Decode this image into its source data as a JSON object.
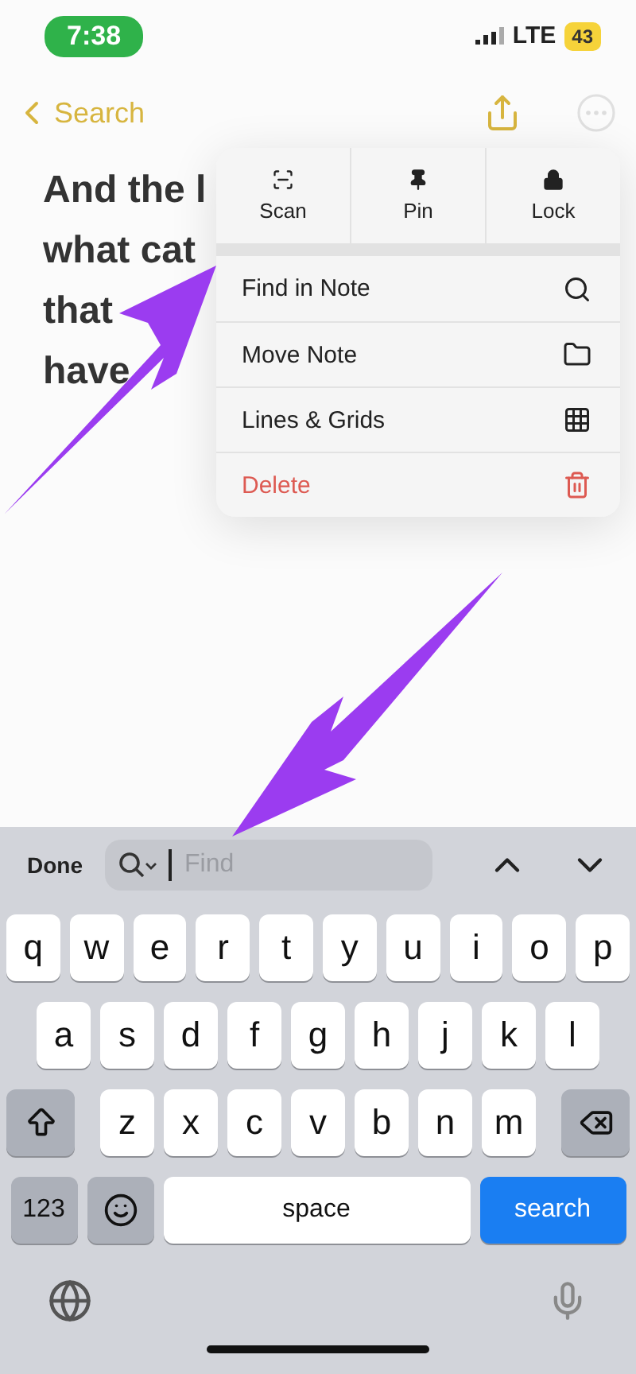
{
  "status_bar": {
    "time": "7:38",
    "network": "LTE",
    "battery": "43"
  },
  "nav": {
    "back_label": "Search"
  },
  "note": {
    "lines": [
      "And the l",
      "what cat",
      "that",
      "have"
    ]
  },
  "menu": {
    "actions": [
      {
        "label": "Scan",
        "kind": "scan"
      },
      {
        "label": "Pin",
        "kind": "pin"
      },
      {
        "label": "Lock",
        "kind": "lock"
      }
    ],
    "items": [
      {
        "label": "Find in Note",
        "kind": "find"
      },
      {
        "label": "Move Note",
        "kind": "move"
      },
      {
        "label": "Lines & Grids",
        "kind": "grid"
      },
      {
        "label": "Delete",
        "kind": "delete"
      }
    ]
  },
  "find_bar": {
    "done": "Done",
    "placeholder": "Find"
  },
  "keyboard": {
    "rows": [
      [
        "q",
        "w",
        "e",
        "r",
        "t",
        "y",
        "u",
        "i",
        "o",
        "p"
      ],
      [
        "a",
        "s",
        "d",
        "f",
        "g",
        "h",
        "j",
        "k",
        "l"
      ],
      [
        "z",
        "x",
        "c",
        "v",
        "b",
        "n",
        "m"
      ]
    ],
    "numbers": "123",
    "space": "space",
    "action": "search"
  }
}
